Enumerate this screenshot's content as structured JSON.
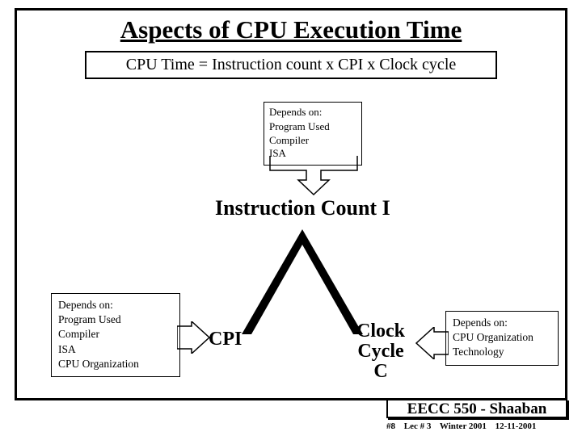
{
  "title": "Aspects of CPU Execution Time",
  "formula": "CPU Time = Instruction count  x  CPI  x  Clock cycle",
  "depends_top": {
    "heading": "Depends on:",
    "line1": "Program Used",
    "line2": "Compiler",
    "line3": "ISA"
  },
  "ic_label": "Instruction Count   I",
  "cpi_label": "CPI",
  "clock_label_l1": "Clock",
  "clock_label_l2": "Cycle",
  "clock_label_l3": "C",
  "depends_left": {
    "heading": "Depends on:",
    "line1": "Program Used",
    "line2": "Compiler",
    "line3": "ISA",
    "line4": "CPU Organization"
  },
  "depends_right": {
    "heading": "Depends on:",
    "line1": "CPU Organization",
    "line2": "Technology"
  },
  "footer_title": "EECC 550 - Shaaban",
  "footer_meta": {
    "page": "#8",
    "lec": "Lec # 3",
    "term": "Winter 2001",
    "date": "12-11-2001"
  }
}
